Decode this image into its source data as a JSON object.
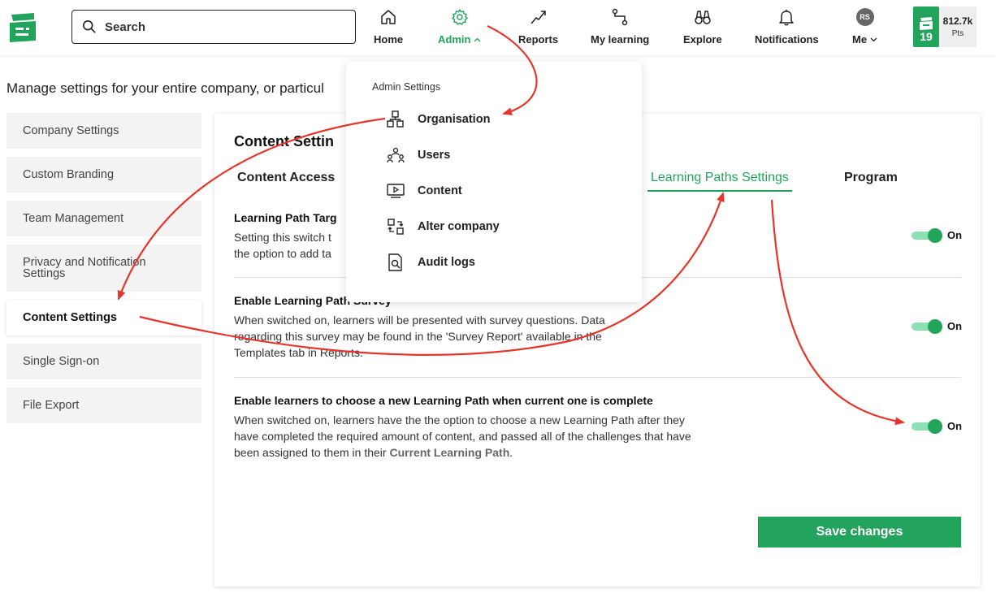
{
  "app": {
    "brand_color": "#22a45d"
  },
  "search": {
    "placeholder": "Search"
  },
  "nav": {
    "home": "Home",
    "admin": "Admin",
    "reports": "Reports",
    "my_learning": "My learning",
    "explore": "Explore",
    "notifications": "Notifications",
    "me": "Me",
    "avatar_initials": "RS"
  },
  "points": {
    "level": "19",
    "value": "812.7k",
    "unit": "Pts"
  },
  "intro": "Manage settings for your entire company, or particul",
  "sidebar": {
    "items": [
      {
        "label": "Company Settings"
      },
      {
        "label": "Custom Branding"
      },
      {
        "label": "Team Management"
      },
      {
        "label": "Privacy and Notification Settings"
      },
      {
        "label": "Content Settings",
        "active": true
      },
      {
        "label": "Single Sign-on"
      },
      {
        "label": "File Export"
      }
    ]
  },
  "panel": {
    "title": "Content Settin",
    "tabs": [
      {
        "label": "Content Access"
      },
      {
        "label": "Learning Paths Settings",
        "active": true
      },
      {
        "label": "Program"
      }
    ]
  },
  "settings": [
    {
      "title": "Learning Path Targ",
      "desc": "Setting this switch t",
      "desc2": "the option to add ta",
      "state": "On"
    },
    {
      "title": "Enable Learning Path Survey",
      "desc": "When switched on, learners will be presented with survey questions. Data regarding this survey may be found in the 'Survey Report' available in the Templates tab in Reports.",
      "state": "On"
    },
    {
      "title": "Enable learners to choose a new Learning Path when current one is complete",
      "desc": "When switched on, learners have the the option to choose a new Learning Path after they have completed the required amount of content, and passed all of the challenges that have been assigned to them in their",
      "desc_strong": "Current Learning Path",
      "desc_end": ".",
      "state": "On"
    }
  ],
  "save_label": "Save changes",
  "dropdown": {
    "header": "Admin Settings",
    "items": [
      {
        "label": "Organisation",
        "icon": "organisation-icon"
      },
      {
        "label": "Users",
        "icon": "users-icon"
      },
      {
        "label": "Content",
        "icon": "content-icon"
      },
      {
        "label": "Alter company",
        "icon": "alter-company-icon"
      },
      {
        "label": "Audit logs",
        "icon": "audit-logs-icon"
      }
    ]
  },
  "annotation_color": "#e8352b"
}
